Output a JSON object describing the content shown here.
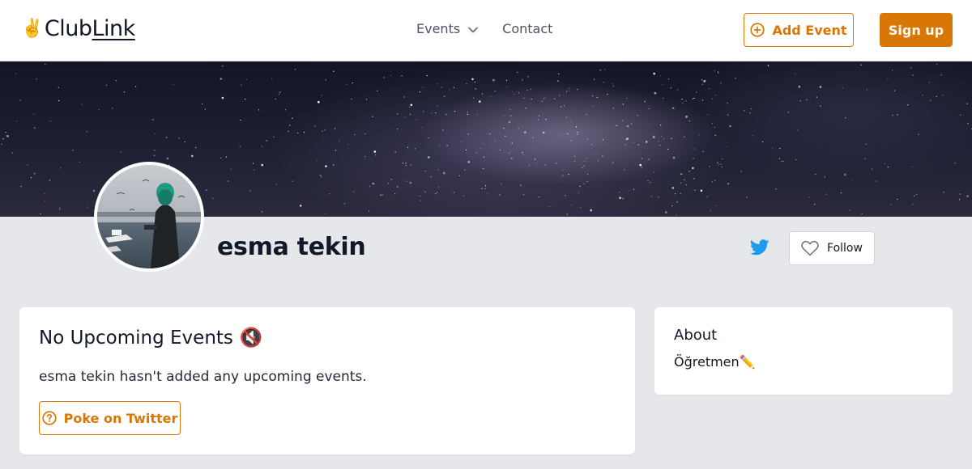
{
  "nav": {
    "logo_hand": "✌️",
    "logo_club": "Club",
    "logo_link": "Link",
    "events_label": "Events",
    "contact_label": "Contact",
    "add_event_label": "Add Event",
    "sign_up_label": "Sign up"
  },
  "profile": {
    "name": "esma tekin",
    "follow_label": "Follow"
  },
  "events": {
    "title": "No Upcoming Events",
    "title_emoji": "🔇",
    "message": "esma tekin hasn't added any upcoming events.",
    "poke_label": "Poke on Twitter"
  },
  "about": {
    "title": "About",
    "text": "Öğretmen✏️"
  },
  "icons": {
    "events_dropdown": "chevron-down-icon",
    "add_event": "plus-circle-icon",
    "twitter": "twitter-icon",
    "follow": "heart-icon",
    "poke": "question-circle-icon",
    "muted": "muted-speaker-icon"
  },
  "colors": {
    "accent": "#d97706",
    "twitter": "#1d9bf0",
    "background": "#e5e7eb"
  }
}
